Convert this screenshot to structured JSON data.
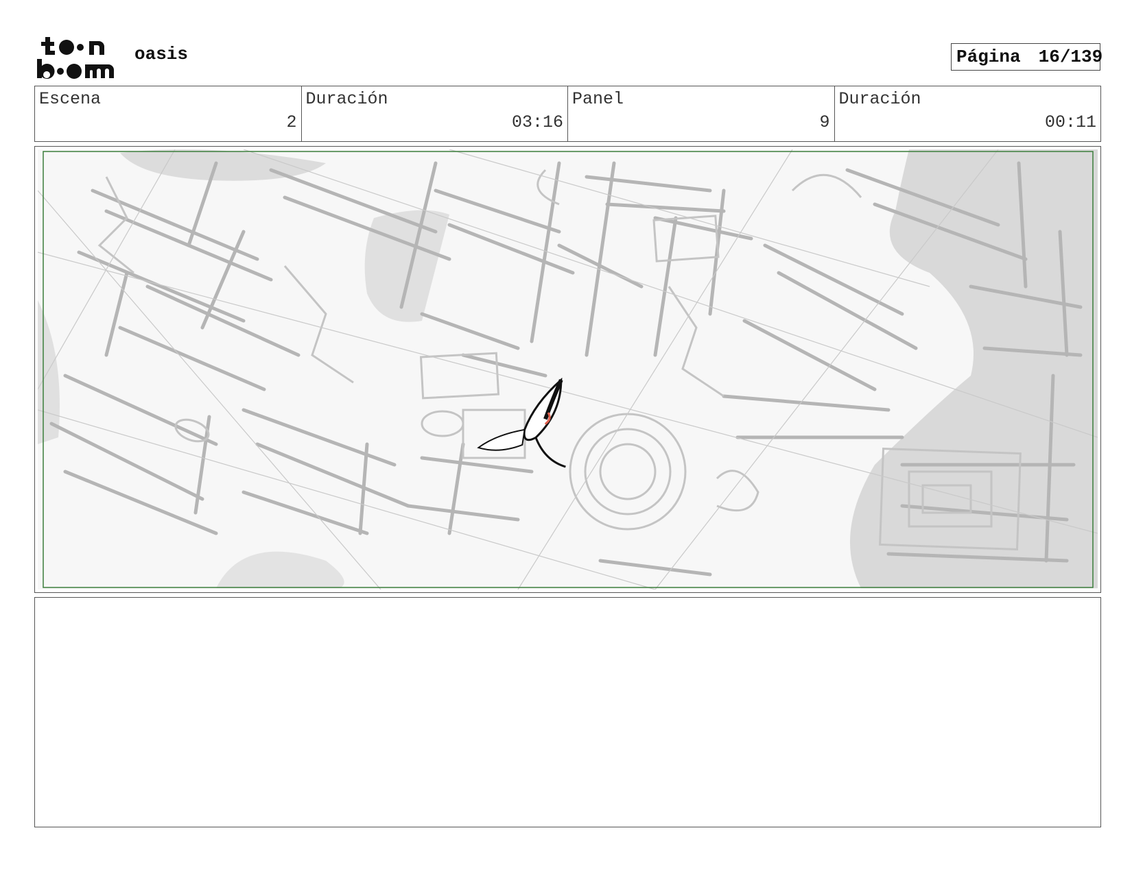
{
  "header": {
    "logo_text": "toon boom",
    "project_name": "oasis",
    "page_label": "Página",
    "page_number": "16/139"
  },
  "info": [
    {
      "label": "Escena",
      "value": "2"
    },
    {
      "label": "Duración",
      "value": "03:16"
    },
    {
      "label": "Panel",
      "value": "9"
    },
    {
      "label": "Duración",
      "value": "00:11"
    }
  ],
  "panel_image": {
    "description_icon": "storyboard-sketch-bird-over-city",
    "safe_frame_color": "#2e7d32"
  },
  "notes": {
    "text": ""
  }
}
